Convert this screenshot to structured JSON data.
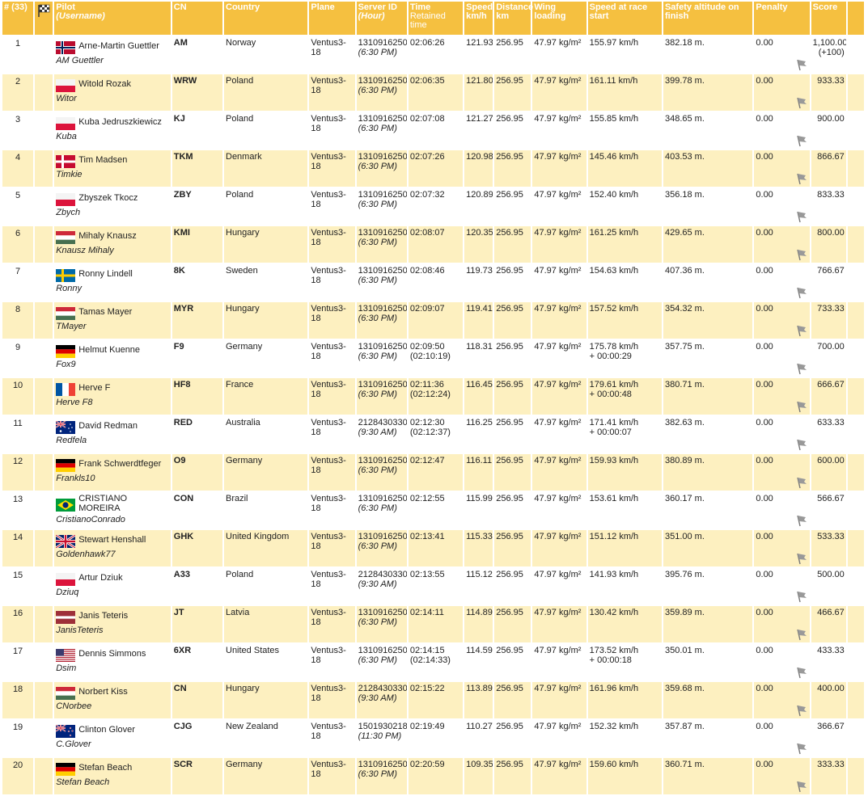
{
  "header": {
    "rank": "# (33)",
    "pilot": "Pilot",
    "username": "(Username)",
    "cn": "CN",
    "country": "Country",
    "plane": "Plane",
    "server_id": "Server ID",
    "hour": "(Hour)",
    "time": "Time",
    "retained": "Retained time",
    "speed": "Speed km/h",
    "distance": "Distance km",
    "wing": "Wing loading",
    "speed_start": "Speed at race start",
    "safety": "Safety altitude on finish",
    "penalty": "Penalty",
    "score": "Score"
  },
  "rows": [
    {
      "rank": "1",
      "flag": "norway",
      "name": "Arne-Martin Guettler",
      "user": "AM Guettler",
      "cn": "AM",
      "country": "Norway",
      "plane": "Ventus3-18",
      "server": "1310916250",
      "hour": "(6:30 PM)",
      "time": "02:06:26",
      "retained": "",
      "speed": "121.93",
      "dist": "256.95",
      "wing": "47.97 kg/m²",
      "start": "155.97 km/h",
      "start2": "",
      "safety": "382.18 m.",
      "penalty": "0.00",
      "score": "1,100.00",
      "score2": "(+100)"
    },
    {
      "rank": "2",
      "flag": "poland",
      "name": "Witold Rozak",
      "user": "Witor",
      "cn": "WRW",
      "country": "Poland",
      "plane": "Ventus3-18",
      "server": "1310916250",
      "hour": "(6:30 PM)",
      "time": "02:06:35",
      "retained": "",
      "speed": "121.80",
      "dist": "256.95",
      "wing": "47.97 kg/m²",
      "start": "161.11 km/h",
      "start2": "",
      "safety": "399.78 m.",
      "penalty": "0.00",
      "score": "933.33",
      "score2": ""
    },
    {
      "rank": "3",
      "flag": "poland",
      "name": "Kuba Jedruszkiewicz",
      "user": "Kuba",
      "cn": "KJ",
      "country": "Poland",
      "plane": "Ventus3-18",
      "server": "1310916250",
      "hour": "(6:30 PM)",
      "time": "02:07:08",
      "retained": "",
      "speed": "121.27",
      "dist": "256.95",
      "wing": "47.97 kg/m²",
      "start": "155.85 km/h",
      "start2": "",
      "safety": "348.65 m.",
      "penalty": "0.00",
      "score": "900.00",
      "score2": ""
    },
    {
      "rank": "4",
      "flag": "denmark",
      "name": "Tim Madsen",
      "user": "Timkie",
      "cn": "TKM",
      "country": "Denmark",
      "plane": "Ventus3-18",
      "server": "1310916250",
      "hour": "(6:30 PM)",
      "time": "02:07:26",
      "retained": "",
      "speed": "120.98",
      "dist": "256.95",
      "wing": "47.97 kg/m²",
      "start": "145.46 km/h",
      "start2": "",
      "safety": "403.53 m.",
      "penalty": "0.00",
      "score": "866.67",
      "score2": ""
    },
    {
      "rank": "5",
      "flag": "poland",
      "name": "Zbyszek Tkocz",
      "user": "Zbych",
      "cn": "ZBY",
      "country": "Poland",
      "plane": "Ventus3-18",
      "server": "1310916250",
      "hour": "(6:30 PM)",
      "time": "02:07:32",
      "retained": "",
      "speed": "120.89",
      "dist": "256.95",
      "wing": "47.97 kg/m²",
      "start": "152.40 km/h",
      "start2": "",
      "safety": "356.18 m.",
      "penalty": "0.00",
      "score": "833.33",
      "score2": ""
    },
    {
      "rank": "6",
      "flag": "hungary",
      "name": "Mihaly Knausz",
      "user": "Knausz Mihaly",
      "cn": "KMI",
      "country": "Hungary",
      "plane": "Ventus3-18",
      "server": "1310916250",
      "hour": "(6:30 PM)",
      "time": "02:08:07",
      "retained": "",
      "speed": "120.35",
      "dist": "256.95",
      "wing": "47.97 kg/m²",
      "start": "161.25 km/h",
      "start2": "",
      "safety": "429.65 m.",
      "penalty": "0.00",
      "score": "800.00",
      "score2": ""
    },
    {
      "rank": "7",
      "flag": "sweden",
      "name": "Ronny Lindell",
      "user": "Ronny",
      "cn": "8K",
      "country": "Sweden",
      "plane": "Ventus3-18",
      "server": "1310916250",
      "hour": "(6:30 PM)",
      "time": "02:08:46",
      "retained": "",
      "speed": "119.73",
      "dist": "256.95",
      "wing": "47.97 kg/m²",
      "start": "154.63 km/h",
      "start2": "",
      "safety": "407.36 m.",
      "penalty": "0.00",
      "score": "766.67",
      "score2": ""
    },
    {
      "rank": "8",
      "flag": "hungary",
      "name": "Tamas Mayer",
      "user": "TMayer",
      "cn": "MYR",
      "country": "Hungary",
      "plane": "Ventus3-18",
      "server": "1310916250",
      "hour": "(6:30 PM)",
      "time": "02:09:07",
      "retained": "",
      "speed": "119.41",
      "dist": "256.95",
      "wing": "47.97 kg/m²",
      "start": "157.52 km/h",
      "start2": "",
      "safety": "354.32 m.",
      "penalty": "0.00",
      "score": "733.33",
      "score2": ""
    },
    {
      "rank": "9",
      "flag": "germany",
      "name": "Helmut Kuenne",
      "user": "Fox9",
      "cn": "F9",
      "country": "Germany",
      "plane": "Ventus3-18",
      "server": "1310916250",
      "hour": "(6:30 PM)",
      "time": "02:09:50",
      "retained": "(02:10:19)",
      "speed": "118.31",
      "dist": "256.95",
      "wing": "47.97 kg/m²",
      "start": "175.78 km/h",
      "start2": "+ 00:00:29",
      "safety": "357.75 m.",
      "penalty": "0.00",
      "score": "700.00",
      "score2": ""
    },
    {
      "rank": "10",
      "flag": "france",
      "name": "Herve F",
      "user": "Herve F8",
      "cn": "HF8",
      "country": "France",
      "plane": "Ventus3-18",
      "server": "1310916250",
      "hour": "(6:30 PM)",
      "time": "02:11:36",
      "retained": "(02:12:24)",
      "speed": "116.45",
      "dist": "256.95",
      "wing": "47.97 kg/m²",
      "start": "179.61 km/h",
      "start2": "+ 00:00:48",
      "safety": "380.71 m.",
      "penalty": "0.00",
      "score": "666.67",
      "score2": ""
    },
    {
      "rank": "11",
      "flag": "australia",
      "name": "David Redman",
      "user": "Redfela",
      "cn": "RED",
      "country": "Australia",
      "plane": "Ventus3-18",
      "server": "2128430330",
      "hour": "(9:30 AM)",
      "time": "02:12:30",
      "retained": "(02:12:37)",
      "speed": "116.25",
      "dist": "256.95",
      "wing": "47.97 kg/m²",
      "start": "171.41 km/h",
      "start2": "+ 00:00:07",
      "safety": "382.63 m.",
      "penalty": "0.00",
      "score": "633.33",
      "score2": ""
    },
    {
      "rank": "12",
      "flag": "germany",
      "name": "Frank Schwerdtfeger",
      "user": "Frankls10",
      "cn": "O9",
      "country": "Germany",
      "plane": "Ventus3-18",
      "server": "1310916250",
      "hour": "(6:30 PM)",
      "time": "02:12:47",
      "retained": "",
      "speed": "116.11",
      "dist": "256.95",
      "wing": "47.97 kg/m²",
      "start": "159.93 km/h",
      "start2": "",
      "safety": "380.89 m.",
      "penalty": "0.00",
      "score": "600.00",
      "score2": ""
    },
    {
      "rank": "13",
      "flag": "brazil",
      "name": "CRISTIANO MOREIRA",
      "user": "CristianoConrado",
      "cn": "CON",
      "country": "Brazil",
      "plane": "Ventus3-18",
      "server": "1310916250",
      "hour": "(6:30 PM)",
      "time": "02:12:55",
      "retained": "",
      "speed": "115.99",
      "dist": "256.95",
      "wing": "47.97 kg/m²",
      "start": "153.61 km/h",
      "start2": "",
      "safety": "360.17 m.",
      "penalty": "0.00",
      "score": "566.67",
      "score2": ""
    },
    {
      "rank": "14",
      "flag": "uk",
      "name": "Stewart Henshall",
      "user": "Goldenhawk77",
      "cn": "GHK",
      "country": "United Kingdom",
      "plane": "Ventus3-18",
      "server": "1310916250",
      "hour": "(6:30 PM)",
      "time": "02:13:41",
      "retained": "",
      "speed": "115.33",
      "dist": "256.95",
      "wing": "47.97 kg/m²",
      "start": "151.12 km/h",
      "start2": "",
      "safety": "351.00 m.",
      "penalty": "0.00",
      "score": "533.33",
      "score2": ""
    },
    {
      "rank": "15",
      "flag": "poland",
      "name": "Artur Dziuk",
      "user": "Dziuq",
      "cn": "A33",
      "country": "Poland",
      "plane": "Ventus3-18",
      "server": "2128430330",
      "hour": "(9:30 AM)",
      "time": "02:13:55",
      "retained": "",
      "speed": "115.12",
      "dist": "256.95",
      "wing": "47.97 kg/m²",
      "start": "141.93 km/h",
      "start2": "",
      "safety": "395.76 m.",
      "penalty": "0.00",
      "score": "500.00",
      "score2": ""
    },
    {
      "rank": "16",
      "flag": "latvia",
      "name": "Janis Teteris",
      "user": "JanisTeteris",
      "cn": "JT",
      "country": "Latvia",
      "plane": "Ventus3-18",
      "server": "1310916250",
      "hour": "(6:30 PM)",
      "time": "02:14:11",
      "retained": "",
      "speed": "114.89",
      "dist": "256.95",
      "wing": "47.97 kg/m²",
      "start": "130.42 km/h",
      "start2": "",
      "safety": "359.89 m.",
      "penalty": "0.00",
      "score": "466.67",
      "score2": ""
    },
    {
      "rank": "17",
      "flag": "usa",
      "name": "Dennis Simmons",
      "user": "Dsim",
      "cn": "6XR",
      "country": "United States",
      "plane": "Ventus3-18",
      "server": "1310916250",
      "hour": "(6:30 PM)",
      "time": "02:14:15",
      "retained": "(02:14:33)",
      "speed": "114.59",
      "dist": "256.95",
      "wing": "47.97 kg/m²",
      "start": "173.52 km/h",
      "start2": "+ 00:00:18",
      "safety": "350.01 m.",
      "penalty": "0.00",
      "score": "433.33",
      "score2": ""
    },
    {
      "rank": "18",
      "flag": "hungary",
      "name": "Norbert Kiss",
      "user": "CNorbee",
      "cn": "CN",
      "country": "Hungary",
      "plane": "Ventus3-18",
      "server": "2128430330",
      "hour": "(9:30 AM)",
      "time": "02:15:22",
      "retained": "",
      "speed": "113.89",
      "dist": "256.95",
      "wing": "47.97 kg/m²",
      "start": "161.96 km/h",
      "start2": "",
      "safety": "359.68 m.",
      "penalty": "0.00",
      "score": "400.00",
      "score2": ""
    },
    {
      "rank": "19",
      "flag": "newzealand",
      "name": "Clinton Glover",
      "user": "C.Glover",
      "cn": "CJG",
      "country": "New Zealand",
      "plane": "Ventus3-18",
      "server": "1501930218",
      "hour": "(11:30 PM)",
      "time": "02:19:49",
      "retained": "",
      "speed": "110.27",
      "dist": "256.95",
      "wing": "47.97 kg/m²",
      "start": "152.32 km/h",
      "start2": "",
      "safety": "357.87 m.",
      "penalty": "0.00",
      "score": "366.67",
      "score2": ""
    },
    {
      "rank": "20",
      "flag": "germany",
      "name": "Stefan Beach",
      "user": "Stefan Beach",
      "cn": "SCR",
      "country": "Germany",
      "plane": "Ventus3-18",
      "server": "1310916250",
      "hour": "(6:30 PM)",
      "time": "02:20:59",
      "retained": "",
      "speed": "109.35",
      "dist": "256.95",
      "wing": "47.97 kg/m²",
      "start": "159.60 km/h",
      "start2": "",
      "safety": "360.71 m.",
      "penalty": "0.00",
      "score": "333.33",
      "score2": ""
    }
  ]
}
